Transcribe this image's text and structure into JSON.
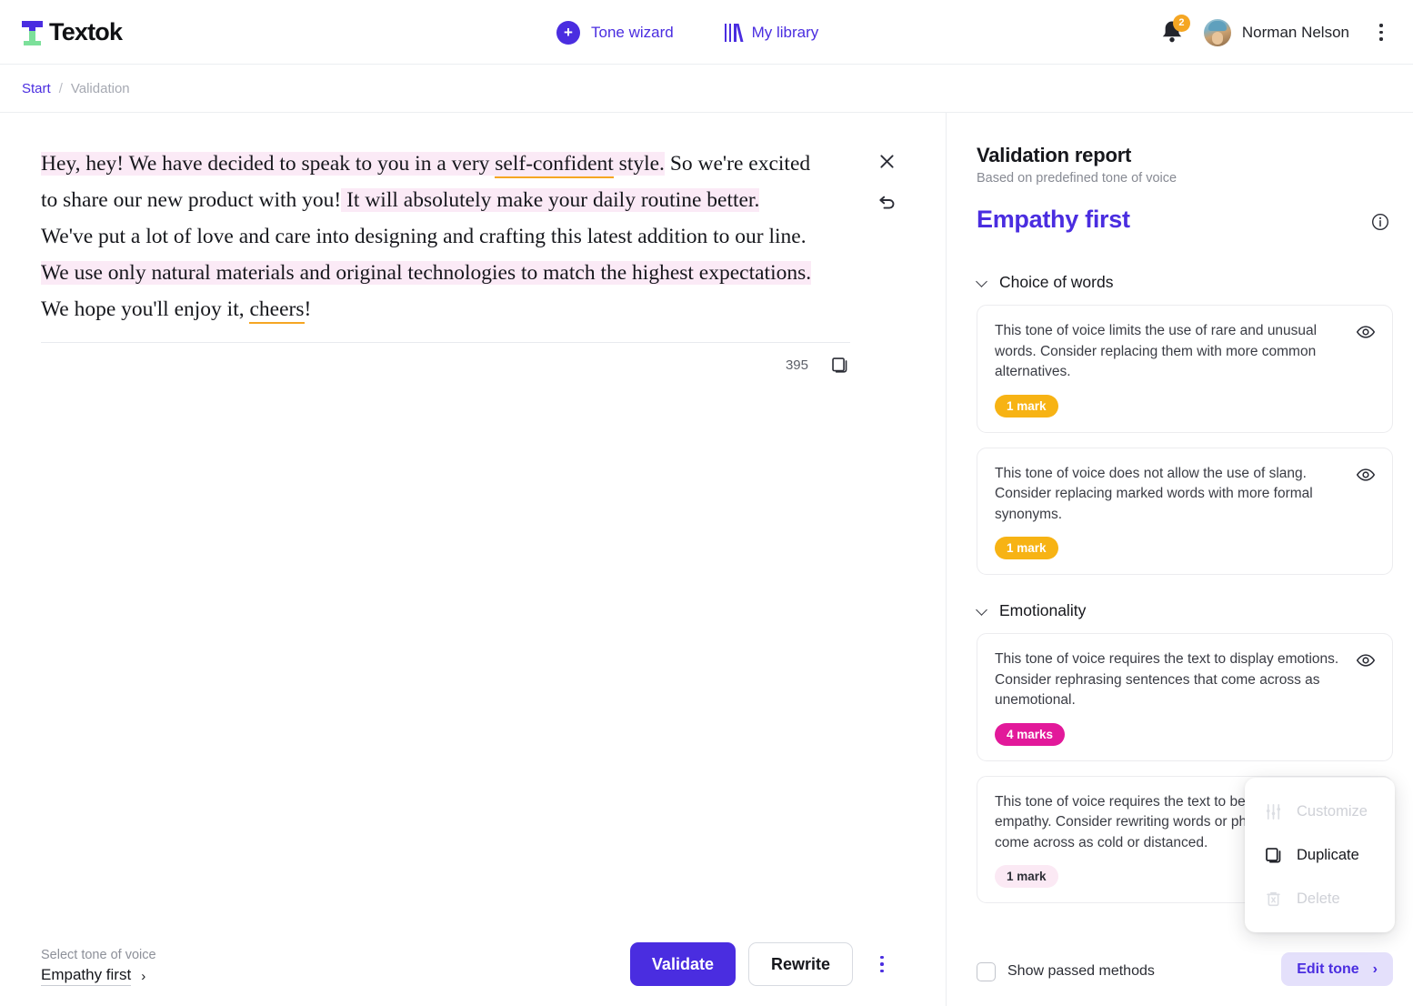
{
  "header": {
    "brand_name": "Textok",
    "nav": [
      {
        "label": "Tone wizard",
        "icon": "plus-circle-icon"
      },
      {
        "label": "My library",
        "icon": "library-books-icon"
      }
    ],
    "notification_count": "2",
    "user_name": "Norman Nelson"
  },
  "breadcrumb": {
    "root": "Start",
    "separator": "/",
    "current": "Validation"
  },
  "editor": {
    "paragraphs": [
      {
        "parts": [
          {
            "text": "Hey, hey! We have decided to speak to you in a very ",
            "highlight": true
          },
          {
            "text": "self-confident",
            "highlight": true,
            "underline": true
          },
          {
            "text": " style.",
            "highlight": true
          },
          {
            "text": " So we're excited",
            "highlight": false
          }
        ]
      },
      {
        "parts": [
          {
            "text": "to  share our new product with you!",
            "highlight": false
          },
          {
            "text": " It will absolutely make your daily routine better.",
            "highlight": true
          }
        ]
      },
      {
        "parts": [
          {
            "text": "We've put a lot of love and care into designing and crafting this latest addition to our line.",
            "highlight": false
          }
        ]
      },
      {
        "parts": [
          {
            "text": "We use only natural materials and original technologies to match the highest expectations.",
            "highlight": true
          }
        ]
      },
      {
        "parts": [
          {
            "text": "We hope you'll enjoy it, ",
            "highlight": false
          },
          {
            "text": "cheers",
            "highlight": false,
            "underline": true
          },
          {
            "text": "!",
            "highlight": false
          }
        ]
      }
    ],
    "char_count": "395",
    "close_icon": "close-icon",
    "undo_icon": "undo-icon",
    "copy_icon": "copy-icon"
  },
  "bottom_bar": {
    "tone_label": "Select tone of voice",
    "tone_value": "Empathy first",
    "validate_label": "Validate",
    "rewrite_label": "Rewrite"
  },
  "report": {
    "title": "Validation report",
    "subtitle": "Based on predefined tone of voice",
    "tone_name": "Empathy first",
    "info_icon": "info-icon",
    "sections": [
      {
        "title": "Choice of words",
        "cards": [
          {
            "text": "This tone of voice limits the use of rare and unusual words. Consider replacing them with more common alternatives.",
            "badge": "1 mark",
            "badge_style": "amber",
            "eye_icon": "eye-icon"
          },
          {
            "text": "This tone of voice does not allow the use of slang. Consider replacing marked words with more formal synonyms.",
            "badge": "1 mark",
            "badge_style": "amber",
            "eye_icon": "eye-icon"
          }
        ]
      },
      {
        "title": "Emotionality",
        "cards": [
          {
            "text": "This tone of voice requires the text to display emotions. Consider rephrasing sentences that come across as unemotional.",
            "badge": "4 marks",
            "badge_style": "magenta",
            "eye_icon": "eye-icon"
          },
          {
            "text": "This tone of voice requires the text to be written with empathy. Consider rewriting words or phrases that come across as cold or distanced.",
            "badge": "1 mark",
            "badge_style": "softpink",
            "eye_icon": "eye-icon"
          }
        ]
      }
    ],
    "footer": {
      "checkbox_label": "Show passed methods",
      "checkbox_checked": false,
      "edit_tone_label": "Edit tone"
    }
  },
  "context_menu": {
    "items": [
      {
        "label": "Customize",
        "icon": "sliders-icon",
        "disabled": true
      },
      {
        "label": "Duplicate",
        "icon": "duplicate-icon",
        "disabled": false
      },
      {
        "label": "Delete",
        "icon": "trash-icon",
        "disabled": true
      }
    ]
  },
  "colors": {
    "brand_purple": "#4a2de0",
    "amber": "#f7b314",
    "magenta": "#e2199a",
    "highlight_pink": "#fbeaf6",
    "underline_orange": "#f5a623"
  }
}
